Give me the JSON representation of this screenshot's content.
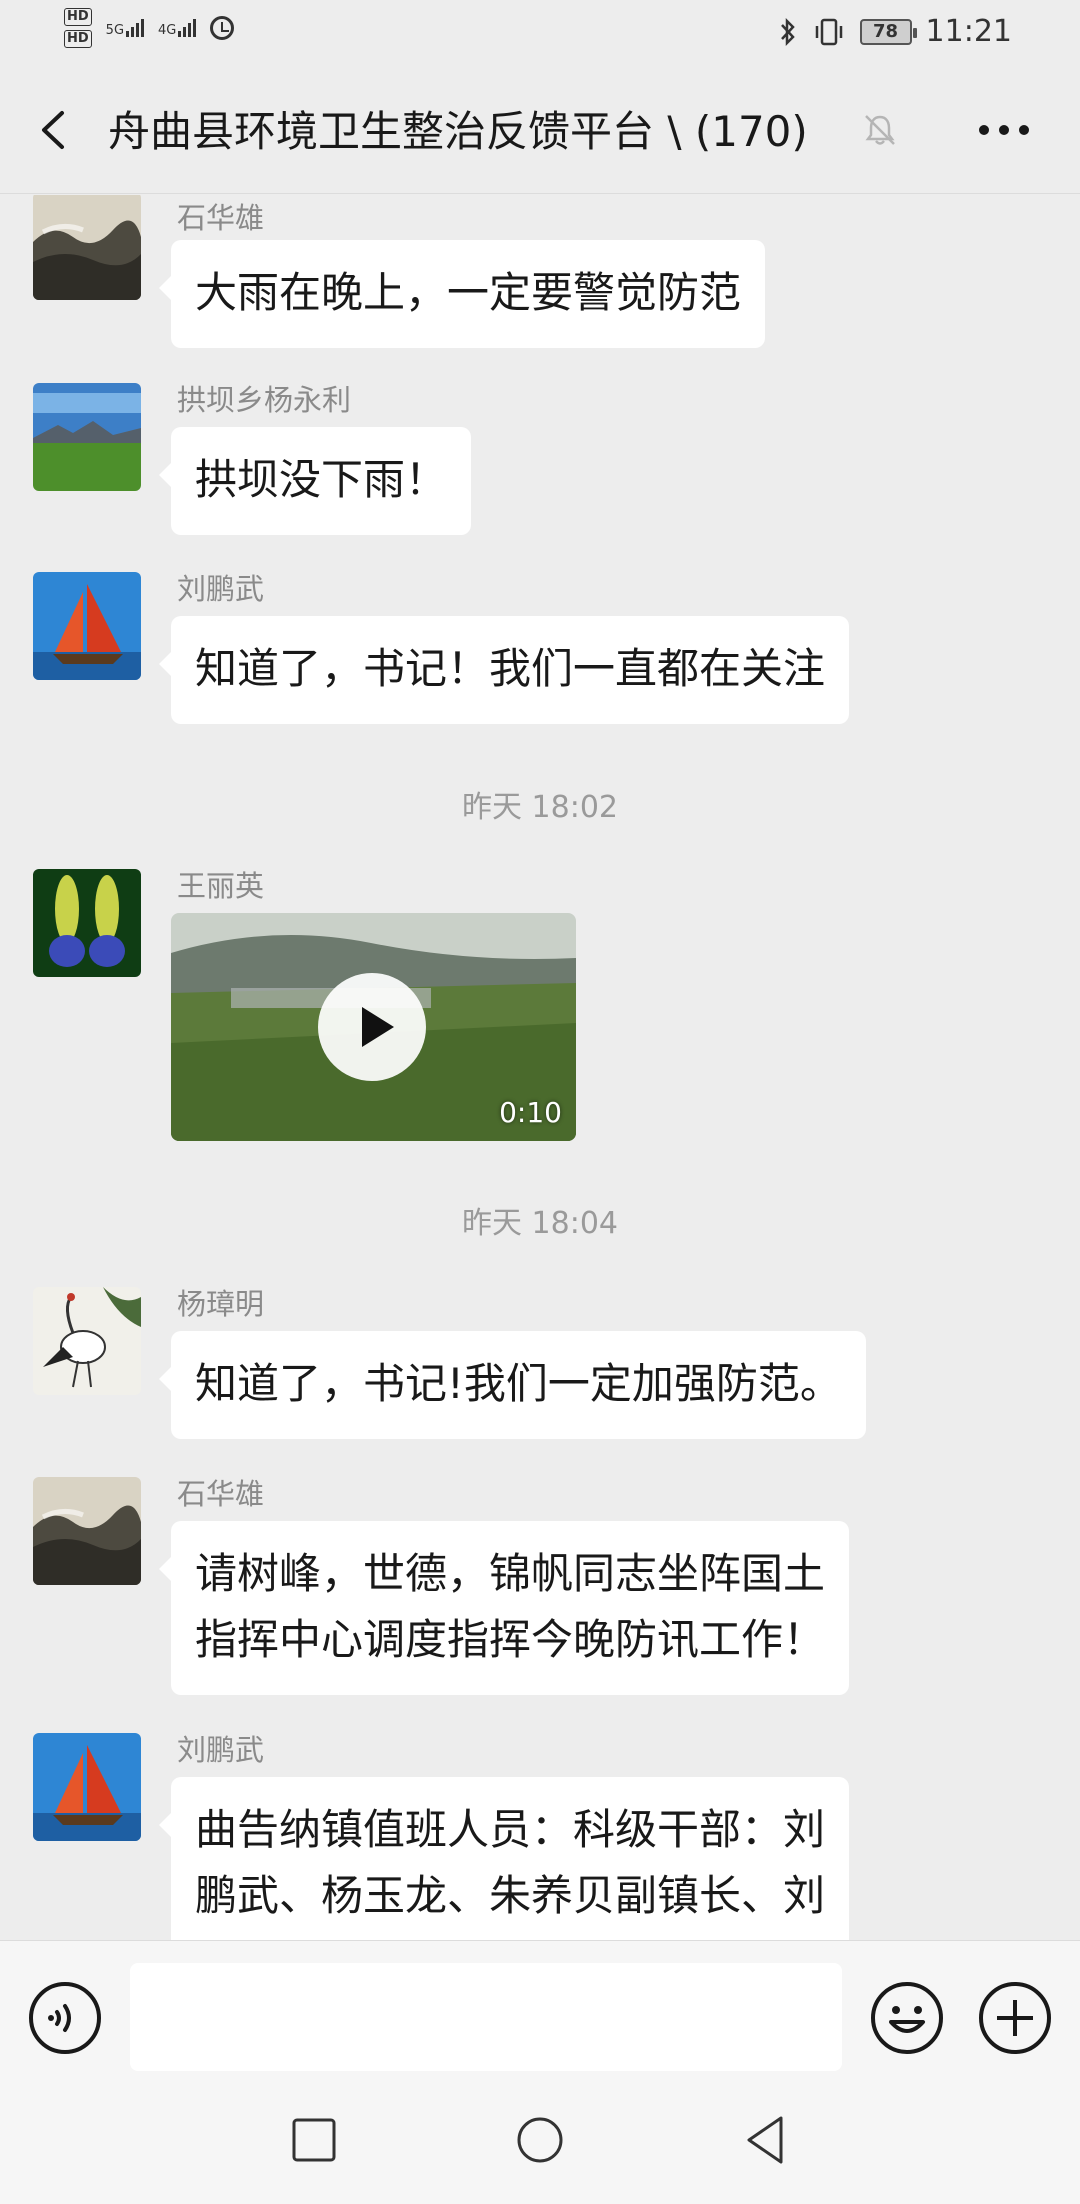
{
  "status_bar": {
    "hd1": "HD",
    "hd2": "HD",
    "network1": "5G",
    "network2": "4G",
    "battery": "78",
    "time": "11:21"
  },
  "nav": {
    "title": "舟曲县环境卫生整治反馈平台 \\ (170)"
  },
  "messages": [
    {
      "sender": "石华雄",
      "text": "大雨在晚上，一定要警觉防范"
    },
    {
      "sender": "拱坝乡杨永利",
      "text": "拱坝没下雨！"
    },
    {
      "sender": "刘鹏武",
      "text": "知道了，书记！我们一直都在关注"
    },
    {
      "timestamp": "昨天 18:02"
    },
    {
      "sender": "王丽英",
      "video_duration": "0:10"
    },
    {
      "timestamp": "昨天 18:04"
    },
    {
      "sender": "杨璋明",
      "text": "知道了，书记!我们一定加强防范。"
    },
    {
      "sender": "石华雄",
      "lines": [
        "请树峰，世德，锦帆同志坐阵国土",
        "指挥中心调度指挥今晚防讯工作！"
      ]
    },
    {
      "sender": "刘鹏武",
      "lines": [
        "曲告纳镇值班人员：科级干部：刘",
        "鹏武、杨玉龙、朱养贝副镇长、刘"
      ]
    }
  ],
  "input": {
    "placeholder": ""
  },
  "colors": {
    "background": "#ededed",
    "bubble": "#ffffff",
    "sender_name": "#8a8a8a",
    "timestamp": "#9a9a9a"
  },
  "icons": [
    "back-icon",
    "mute-bell-icon",
    "more-icon",
    "voice-icon",
    "emoji-icon",
    "plus-icon",
    "recents-icon",
    "home-icon",
    "back-triangle-icon",
    "play-icon",
    "bluetooth-icon",
    "vibrate-icon",
    "alarm-icon"
  ]
}
